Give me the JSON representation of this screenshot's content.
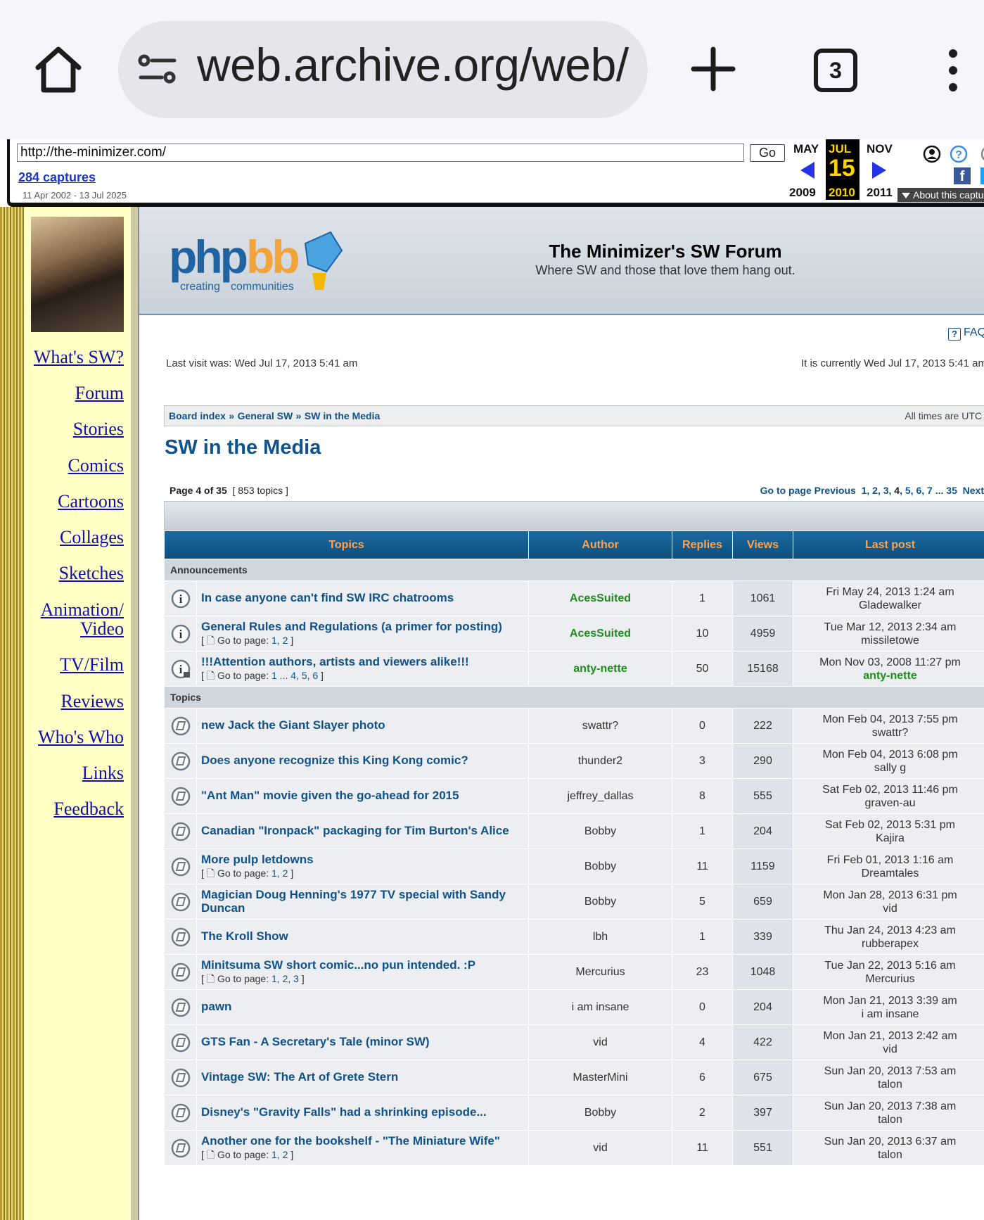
{
  "browser": {
    "url": "web.archive.org/web/",
    "tab_count": "3"
  },
  "wayback": {
    "url_value": "http://the-minimizer.com/",
    "go_label": "Go",
    "captures": "284 captures",
    "range": "11 Apr 2002 - 13 Jul 2025",
    "prev_month": "MAY",
    "cur_month": "JUL",
    "next_month": "NOV",
    "day": "15",
    "prev_year": "2009",
    "cur_year": "2010",
    "next_year": "2011",
    "about": "About this captu"
  },
  "sidebar": {
    "items": [
      {
        "label": "What's SW?"
      },
      {
        "label": "Forum"
      },
      {
        "label": "Stories"
      },
      {
        "label": "Comics"
      },
      {
        "label": "Cartoons"
      },
      {
        "label": "Collages"
      },
      {
        "label": "Sketches"
      },
      {
        "label": "Animation/"
      },
      {
        "label": "Video"
      },
      {
        "label": "TV/Film"
      },
      {
        "label": "Reviews"
      },
      {
        "label": "Who's Who"
      },
      {
        "label": "Links"
      },
      {
        "label": "Feedback"
      }
    ]
  },
  "forum": {
    "title": "The Minimizer's SW Forum",
    "description": "Where SW and those that love them hang out.",
    "faq": "FAQ",
    "last_visit": "Last visit was: Wed Jul 17, 2013 5:41 am",
    "current_time": "It is currently Wed Jul 17, 2013 5:41 am",
    "breadcrumbs": [
      "Board index",
      "General SW",
      "SW in the Media"
    ],
    "crumb_sep": "»",
    "times": "All times are UTC",
    "page_title": "SW in the Media",
    "page_label": "Page",
    "page_cur": "4",
    "page_of": "of",
    "page_total": "35",
    "topic_count": "[ 853 topics ]",
    "pagination": {
      "go_to": "Go to page",
      "previous": "Previous",
      "pages": [
        "1",
        "2",
        "3",
        "4",
        "5",
        "6",
        "7"
      ],
      "ellipsis": "...",
      "last": "35",
      "next": "Next"
    },
    "columns": {
      "topics": "Topics",
      "author": "Author",
      "replies": "Replies",
      "views": "Views",
      "last_post": "Last post"
    },
    "sections": {
      "announcements": "Announcements",
      "topics": "Topics"
    },
    "go_to_page": "Go to page:",
    "announcements": [
      {
        "title": "In case anyone can't find SW IRC chatrooms",
        "pages": "",
        "author": "AcesSuited",
        "author_green": true,
        "replies": "1",
        "views": "1061",
        "last_date": "Fri May 24, 2013 1:24 am",
        "last_user": "Gladewalker",
        "last_green": false,
        "icon": "announce-icon"
      },
      {
        "title": "General Rules and Regulations (a primer for posting)",
        "pages": "1, 2",
        "author": "AcesSuited",
        "author_green": true,
        "replies": "10",
        "views": "4959",
        "last_date": "Tue Mar 12, 2013 2:34 am",
        "last_user": "missiletowe",
        "last_green": false,
        "icon": "announce-icon"
      },
      {
        "title": "!!!Attention authors, artists and viewers alike!!!",
        "pages": "1 ... 4, 5, 6",
        "author": "anty-nette",
        "author_green": true,
        "replies": "50",
        "views": "15168",
        "last_date": "Mon Nov 03, 2008 11:27 pm",
        "last_user": "anty-nette",
        "last_green": true,
        "icon": "locked-announce-icon"
      }
    ],
    "topics": [
      {
        "title": "new Jack the Giant Slayer photo",
        "pages": "",
        "author": "swattr?",
        "replies": "0",
        "views": "222",
        "last_date": "Mon Feb 04, 2013 7:55 pm",
        "last_user": "swattr?"
      },
      {
        "title": "Does anyone recognize this King Kong comic?",
        "pages": "",
        "author": "thunder2",
        "replies": "3",
        "views": "290",
        "last_date": "Mon Feb 04, 2013 6:08 pm",
        "last_user": "sally g"
      },
      {
        "title": "\"Ant Man\" movie given the go-ahead for 2015",
        "pages": "",
        "author": "jeffrey_dallas",
        "replies": "8",
        "views": "555",
        "last_date": "Sat Feb 02, 2013 11:46 pm",
        "last_user": "graven-au"
      },
      {
        "title": "Canadian \"Ironpack\" packaging for Tim Burton's Alice",
        "pages": "",
        "author": "Bobby",
        "replies": "1",
        "views": "204",
        "last_date": "Sat Feb 02, 2013 5:31 pm",
        "last_user": "Kajira"
      },
      {
        "title": "More pulp letdowns",
        "pages": "1, 2",
        "author": "Bobby",
        "replies": "11",
        "views": "1159",
        "last_date": "Fri Feb 01, 2013 1:16 am",
        "last_user": "Dreamtales"
      },
      {
        "title": "Magician Doug Henning's 1977 TV special with Sandy Duncan",
        "pages": "",
        "author": "Bobby",
        "replies": "5",
        "views": "659",
        "last_date": "Mon Jan 28, 2013 6:31 pm",
        "last_user": "vid"
      },
      {
        "title": "The Kroll Show",
        "pages": "",
        "author": "lbh",
        "replies": "1",
        "views": "339",
        "last_date": "Thu Jan 24, 2013 4:23 am",
        "last_user": "rubberapex"
      },
      {
        "title": "Minitsuma SW short comic...no pun intended. :P",
        "pages": "1, 2, 3",
        "author": "Mercurius",
        "replies": "23",
        "views": "1048",
        "last_date": "Tue Jan 22, 2013 5:16 am",
        "last_user": "Mercurius"
      },
      {
        "title": "pawn",
        "pages": "",
        "author": "i am insane",
        "replies": "0",
        "views": "204",
        "last_date": "Mon Jan 21, 2013 3:39 am",
        "last_user": "i am insane"
      },
      {
        "title": "GTS Fan - A Secretary's Tale (minor SW)",
        "pages": "",
        "author": "vid",
        "replies": "4",
        "views": "422",
        "last_date": "Mon Jan 21, 2013 2:42 am",
        "last_user": "vid"
      },
      {
        "title": "Vintage SW: The Art of Grete Stern",
        "pages": "",
        "author": "MasterMini",
        "replies": "6",
        "views": "675",
        "last_date": "Sun Jan 20, 2013 7:53 am",
        "last_user": "talon"
      },
      {
        "title": "Disney's \"Gravity Falls\" had a shrinking episode...",
        "pages": "",
        "author": "Bobby",
        "replies": "2",
        "views": "397",
        "last_date": "Sun Jan 20, 2013 7:38 am",
        "last_user": "talon"
      },
      {
        "title": "Another one for the bookshelf - \"The Miniature Wife\"",
        "pages": "1, 2",
        "author": "vid",
        "replies": "11",
        "views": "551",
        "last_date": "Sun Jan 20, 2013 6:37 am",
        "last_user": "talon"
      }
    ]
  },
  "colors": {
    "link_blue": "#105289",
    "header_orange": "#ffa34f",
    "author_green": "#1f8c1f",
    "sidebar_bg": "#ffffc6",
    "wayback_yellow": "#ffd400"
  }
}
